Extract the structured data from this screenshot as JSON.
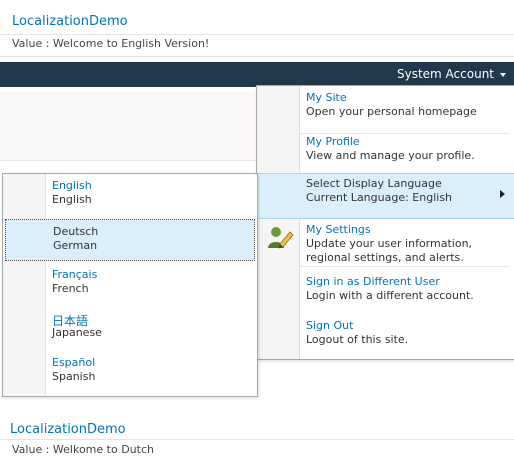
{
  "top": {
    "site_title": "LocalizationDemo",
    "value_text": "Value : Welcome to English Version!"
  },
  "topbar": {
    "account_label": "System Account"
  },
  "menu": {
    "items": [
      {
        "title": "My Site",
        "desc": [
          "Open your personal homepage"
        ]
      },
      {
        "title": "My Profile",
        "desc": [
          "View and manage your profile."
        ]
      },
      {
        "title": "Select Display Language",
        "desc": [
          "Current Language: English"
        ]
      },
      {
        "title": "My Settings",
        "desc": [
          "Update your user information,",
          "regional settings, and alerts."
        ]
      },
      {
        "title": "Sign in as Different User",
        "desc": [
          "Login with a different account."
        ]
      },
      {
        "title": "Sign Out",
        "desc": [
          "Logout of this site."
        ]
      }
    ]
  },
  "languages": {
    "items": [
      {
        "native": "English",
        "english": "English"
      },
      {
        "native": "Deutsch",
        "english": "German"
      },
      {
        "native": "Français",
        "english": "French"
      },
      {
        "native": "日本語",
        "english": "Japanese"
      },
      {
        "native": "Español",
        "english": "Spanish"
      }
    ]
  },
  "bottom": {
    "site_title": "LocalizationDemo",
    "value_text": "Value : Welkome to Dutch"
  },
  "colors": {
    "topbar": "#21374c",
    "link": "#0072bc",
    "highlight": "#dbeefc"
  }
}
